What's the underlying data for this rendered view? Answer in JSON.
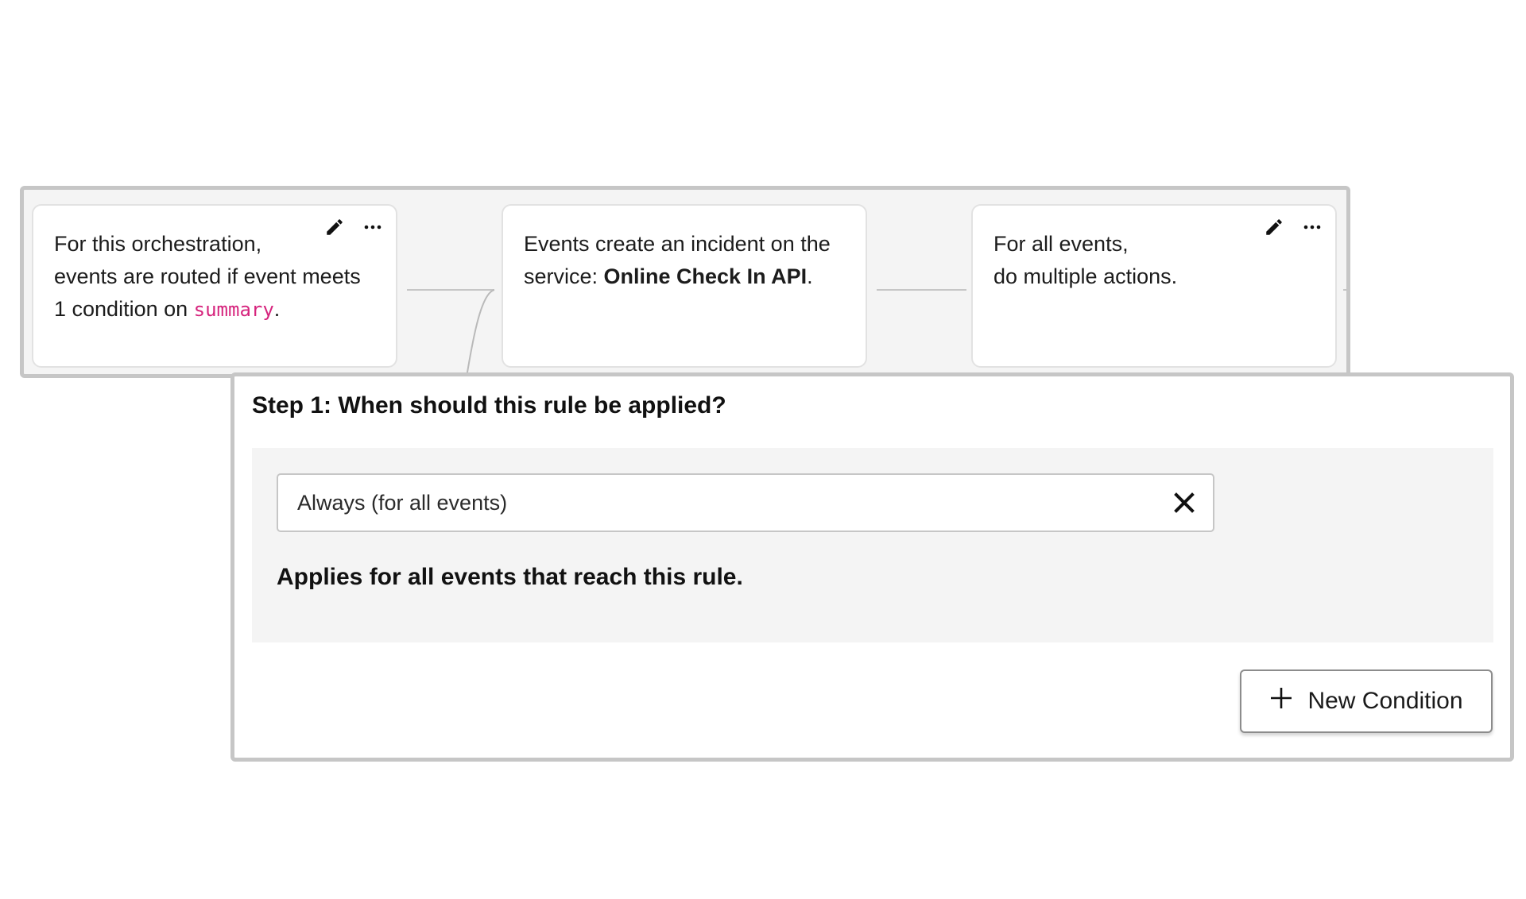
{
  "flow": {
    "cards": [
      {
        "line1": "For this orchestration,",
        "line2": "events are routed if event meets",
        "line3_prefix": "1 condition on ",
        "line3_field": "summary",
        "line3_suffix": ".",
        "edit_icon": "pencil-icon",
        "more_icon": "more-horizontal-icon"
      },
      {
        "line1": "Events create an incident on the",
        "line2_prefix": "service: ",
        "line2_service": "Online Check In API",
        "line2_suffix": "."
      },
      {
        "line1": "For all events,",
        "line2": "do multiple actions.",
        "edit_icon": "pencil-icon",
        "more_icon": "more-horizontal-icon"
      }
    ]
  },
  "step": {
    "title": "Step 1: When should this rule be applied?",
    "condition_value": "Always (for all events)",
    "clear_icon": "close-icon",
    "description": "Applies for all events that reach this rule.",
    "new_condition_label": "New Condition",
    "new_condition_icon": "plus-icon"
  },
  "colors": {
    "field_highlight": "#d6247d",
    "panel_border": "#c6c6c6",
    "panel_background": "#f4f4f4"
  }
}
